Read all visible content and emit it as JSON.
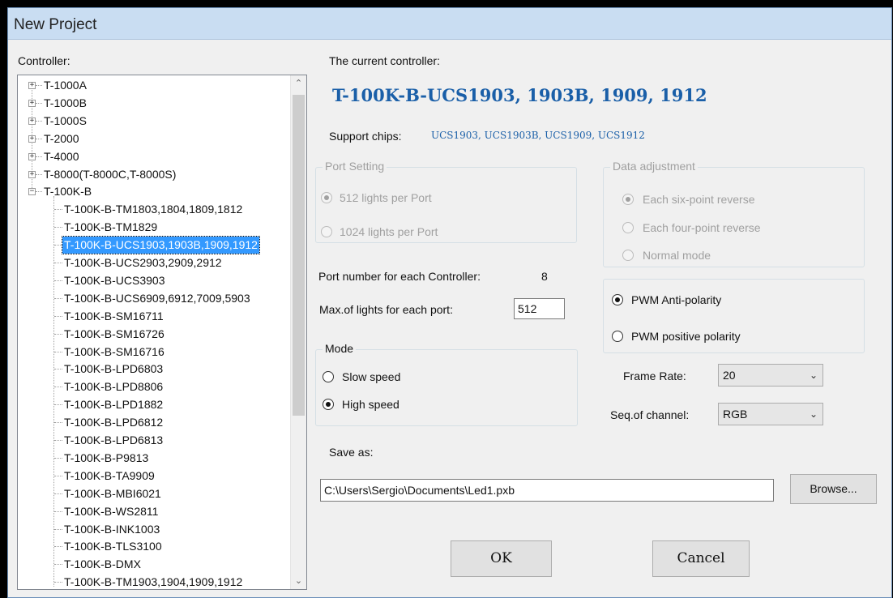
{
  "window": {
    "title": "New Project"
  },
  "controller_label": "Controller:",
  "tree": {
    "roots": [
      {
        "label": "T-1000A",
        "expander": "+"
      },
      {
        "label": "T-1000B",
        "expander": "+"
      },
      {
        "label": "T-1000S",
        "expander": "+"
      },
      {
        "label": "T-2000",
        "expander": "+"
      },
      {
        "label": "T-4000",
        "expander": "+"
      },
      {
        "label": "T-8000(T-8000C,T-8000S)",
        "expander": "+"
      },
      {
        "label": "T-100K-B",
        "expander": "−"
      }
    ],
    "children": [
      "T-100K-B-TM1803,1804,1809,1812",
      "T-100K-B-TM1829",
      "T-100K-B-UCS1903,1903B,1909,1912",
      "T-100K-B-UCS2903,2909,2912",
      "T-100K-B-UCS3903",
      "T-100K-B-UCS6909,6912,7009,5903",
      "T-100K-B-SM16711",
      "T-100K-B-SM16726",
      "T-100K-B-SM16716",
      "T-100K-B-LPD6803",
      "T-100K-B-LPD8806",
      "T-100K-B-LPD1882",
      "T-100K-B-LPD6812",
      "T-100K-B-LPD6813",
      "T-100K-B-P9813",
      "T-100K-B-TA9909",
      "T-100K-B-MBI6021",
      "T-100K-B-WS2811",
      "T-100K-B-INK1003",
      "T-100K-B-TLS3100",
      "T-100K-B-DMX",
      "T-100K-B-TM1903,1904,1909,1912"
    ],
    "selected_index": 2
  },
  "current": {
    "label": "The current controller:",
    "value": "T-100K-B-UCS1903, 1903B, 1909, 1912",
    "value_color": "#1a5fa8"
  },
  "support": {
    "label": "Support chips:",
    "value": "UCS1903, UCS1903B, UCS1909, UCS1912"
  },
  "port_setting": {
    "title": "Port Setting",
    "options": [
      "512 lights per Port",
      "1024 lights per Port"
    ],
    "selected": "512 lights per Port",
    "enabled": false
  },
  "data_adjustment": {
    "title": "Data adjustment",
    "options": [
      "Each six-point reverse",
      "Each four-point reverse",
      "Normal mode"
    ],
    "selected": "Each six-point reverse",
    "enabled": false
  },
  "port_number": {
    "label": "Port number for each Controller:",
    "value": "8"
  },
  "max_lights": {
    "label": "Max.of lights for each port:",
    "value": "512"
  },
  "polarity": {
    "options": [
      "PWM Anti-polarity",
      "PWM positive polarity"
    ],
    "selected": "PWM Anti-polarity"
  },
  "mode": {
    "title": "Mode",
    "options": [
      "Slow speed",
      "High speed"
    ],
    "selected": "High speed"
  },
  "frame_rate": {
    "label": "Frame Rate:",
    "value": "20"
  },
  "seq_channel": {
    "label": "Seq.of channel:",
    "value": "RGB"
  },
  "save_as": {
    "label": "Save as:",
    "path": "C:\\Users\\Sergio\\Documents\\Led1.pxb"
  },
  "buttons": {
    "browse": "Browse...",
    "ok": "OK",
    "cancel": "Cancel"
  },
  "icons": {
    "tree_collapsed": "plus-box-icon",
    "tree_expanded": "minus-box-icon",
    "combo_arrow": "chevron-down-icon"
  }
}
